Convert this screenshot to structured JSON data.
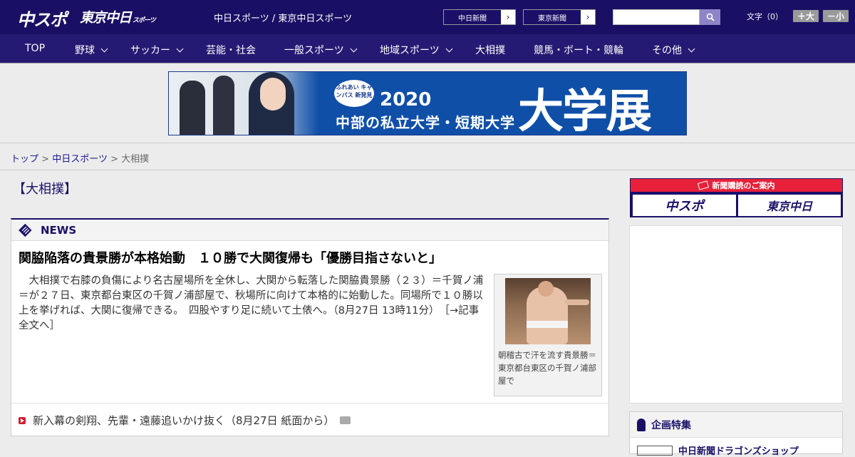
{
  "header": {
    "logo_chunichi_sports": "中スポ",
    "logo_tokyo_chunichi": "東京中日",
    "logo_tokyo_chunichi_small": "スポーツ",
    "site_title": "中日スポーツ / 東京中日スポーツ",
    "paper_link_1": "中日新聞",
    "paper_link_2": "東京新聞",
    "search_placeholder": "",
    "font_label": "文字（0）",
    "font_bigger": "＋大",
    "font_smaller": "－小"
  },
  "nav": [
    {
      "label": "TOP",
      "has_menu": false
    },
    {
      "label": "野球",
      "has_menu": true
    },
    {
      "label": "サッカー",
      "has_menu": true
    },
    {
      "label": "芸能・社会",
      "has_menu": false
    },
    {
      "label": "一般スポーツ",
      "has_menu": true
    },
    {
      "label": "地域スポーツ",
      "has_menu": true
    },
    {
      "label": "大相撲",
      "has_menu": false
    },
    {
      "label": "競馬・ボート・競輪",
      "has_menu": false
    },
    {
      "label": "その他",
      "has_menu": true
    }
  ],
  "banner": {
    "badge": "ふれあい キャンパス 新発見",
    "year": "2020",
    "subtitle": "中部の私立大学・短期大学",
    "big_text": "大学展"
  },
  "breadcrumb": {
    "top": "トップ",
    "sep1": ">",
    "section": "中日スポーツ",
    "sep2": ">",
    "current": "大相撲"
  },
  "category_title": "【大相撲】",
  "news": {
    "heading": "NEWS",
    "headline": "関脇陥落の貴景勝が本格始動　１０勝で大関復帰も「優勝目指さないと」",
    "body": "　大相撲で右膝の負傷により名古屋場所を全休し、大関から転落した関脇貴景勝（２３）＝千賀ノ浦＝が２７日、東京都台東区の千賀ノ浦部屋で、秋場所に向けて本格的に始動した。同場所で１０勝以上を挙げれば、大関に復帰できる。　四股やすり足に続いて土俵へ。（8月27日 13時11分）　［→記事全文へ］",
    "photo_caption": "朝稽古で汗を流す貴景勝＝東京都台東区の千賀ノ浦部屋で",
    "related_link": "新入幕の剣翔、先輩・遠藤追いかけ抜く（8月27日 紙面から）"
  },
  "sidebar": {
    "subscribe_label": "新聞購読のご案内",
    "subscribe_chunichi": "中スポ",
    "subscribe_tokyo": "東京中日",
    "feature_heading": "企画特集",
    "feature_item": "中日新聞ドラゴンズショップ"
  },
  "colors": {
    "brand_navy": "#191065",
    "nav_bg": "#251a73",
    "accent_red": "#e8203a"
  }
}
